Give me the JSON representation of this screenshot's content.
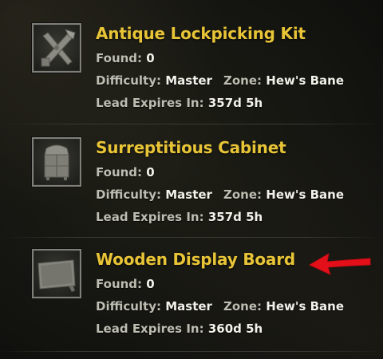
{
  "labels": {
    "found": "Found:",
    "difficulty": "Difficulty:",
    "zone": "Zone:",
    "expires": "Lead Expires In:"
  },
  "entries": [
    {
      "icon": "lockpicking-kit-icon",
      "title": "Antique Lockpicking Kit",
      "found": "0",
      "difficulty": "Master",
      "zone": "Hew's Bane",
      "expires": "357d 5h"
    },
    {
      "icon": "cabinet-icon",
      "title": "Surreptitious Cabinet",
      "found": "0",
      "difficulty": "Master",
      "zone": "Hew's Bane",
      "expires": "357d 5h"
    },
    {
      "icon": "display-board-icon",
      "title": "Wooden Display Board",
      "found": "0",
      "difficulty": "Master",
      "zone": "Hew's Bane",
      "expires": "360d 5h"
    }
  ],
  "colors": {
    "title": "#e8c437",
    "label": "#bdbdb2",
    "value": "#f2f2ea",
    "arrow": "#e3101a"
  }
}
